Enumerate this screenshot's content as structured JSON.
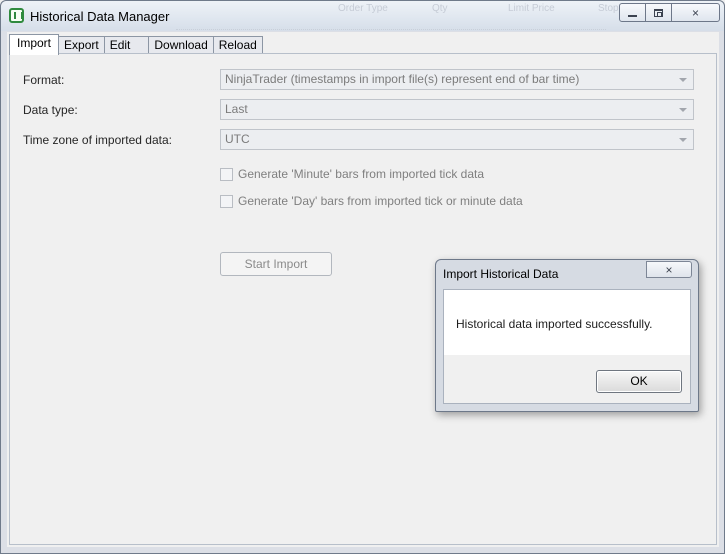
{
  "window": {
    "title": "Historical Data Manager",
    "bg_ghost_headers": [
      "Order Type",
      "Qty",
      "Limit Price",
      "Stop"
    ],
    "controls": {
      "minimize": "minimize",
      "restore": "restore",
      "close": "×"
    }
  },
  "tabs": [
    {
      "label": "Import",
      "active": true
    },
    {
      "label": "Export",
      "active": false
    },
    {
      "label": "Edit",
      "active": false
    },
    {
      "label": "Download",
      "active": false
    },
    {
      "label": "Reload",
      "active": false
    }
  ],
  "import_form": {
    "format_label": "Format:",
    "format_value": "NinjaTrader (timestamps in import file(s) represent end of bar time)",
    "datatype_label": "Data type:",
    "datatype_value": "Last",
    "timezone_label": "Time zone of imported data:",
    "timezone_value": "UTC",
    "checkbox_minute": "Generate 'Minute' bars from imported tick data",
    "checkbox_day": "Generate 'Day' bars from imported tick or minute data",
    "start_button": "Start Import"
  },
  "dialog": {
    "title": "Import Historical Data",
    "message": "Historical data imported successfully.",
    "ok_label": "OK",
    "close_glyph": "×"
  },
  "colors": {
    "accent": "#2f8a3e",
    "disabled_text": "#7b7b7b",
    "window_border": "#6f7a8a"
  }
}
